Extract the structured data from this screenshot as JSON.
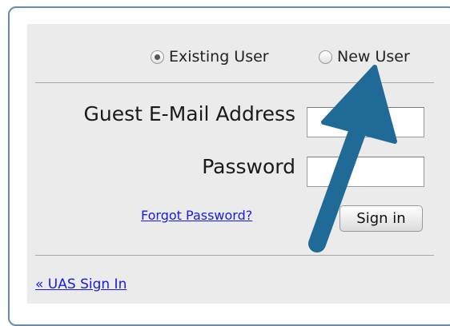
{
  "login": {
    "user_type": {
      "existing_label": "Existing User",
      "new_label": "New User",
      "selected": "Existing User"
    },
    "email_label": "Guest E-Mail Address",
    "email_value": "",
    "password_label": "Password",
    "password_value": "",
    "forgot_password_link": "Forgot Password?",
    "sign_in_button": "Sign in",
    "uas_sign_in_link": "« UAS Sign In"
  },
  "annotation": {
    "arrow_color": "#1f6a96",
    "arrow_icon": "arrow-pointer-icon"
  }
}
